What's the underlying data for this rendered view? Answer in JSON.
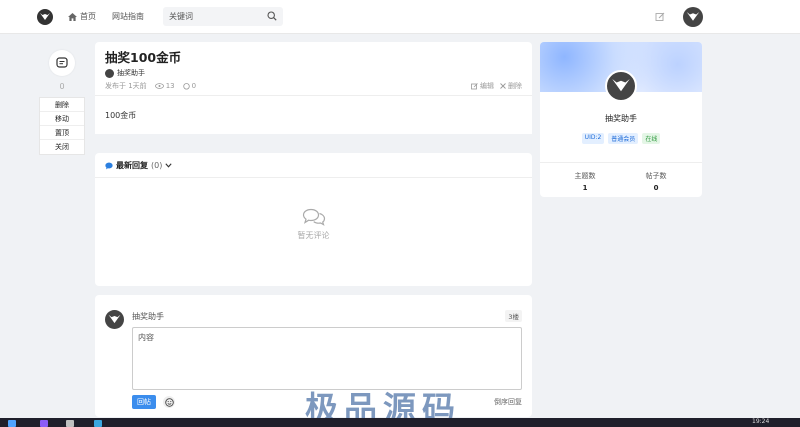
{
  "nav": {
    "home": "首页",
    "guide": "网站指南",
    "search_placeholder": "关键词"
  },
  "side": {
    "count": "0",
    "actions": [
      "删除",
      "移动",
      "置顶",
      "关闭"
    ]
  },
  "post": {
    "title": "抽奖100金币",
    "author": "抽奖助手",
    "published": "发布于 1天前",
    "views": "13",
    "comments": "0",
    "edit": "编辑",
    "delete": "删除",
    "content": "100金币"
  },
  "replies": {
    "title": "最新回复",
    "count": "(0)",
    "empty": "暂无评论"
  },
  "composer": {
    "name": "抽奖助手",
    "tag": "3楼",
    "placeholder": "内容",
    "submit": "回帖",
    "sort": "倒序回复"
  },
  "profile": {
    "name": "抽奖助手",
    "tags": [
      {
        "label": "UID:2",
        "color": "#1d6bd8"
      },
      {
        "label": "普通会员",
        "color": "#1d6bd8"
      },
      {
        "label": "在线",
        "color": "#2f9a3f"
      }
    ],
    "stats": [
      {
        "label": "主题数",
        "value": "1"
      },
      {
        "label": "帖子数",
        "value": "0"
      }
    ]
  },
  "watermark": "极品源码",
  "taskbar": {
    "time": "19:24"
  }
}
